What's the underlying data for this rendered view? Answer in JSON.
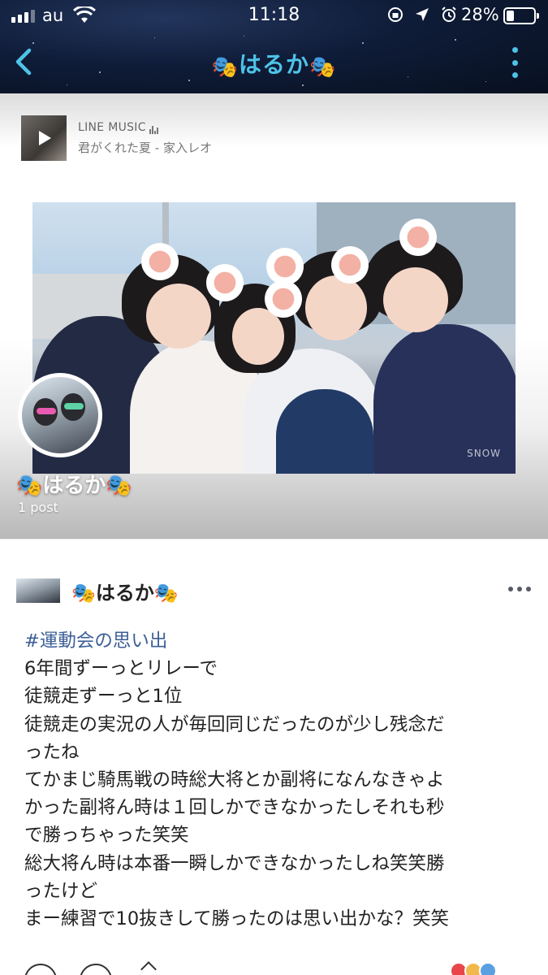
{
  "status_bar": {
    "carrier": "au",
    "time": "11:18",
    "battery_percent": "28%",
    "battery_level": 0.28
  },
  "nav": {
    "title_mask_left": "🎭",
    "title": "はるか",
    "title_mask_right": "🎭"
  },
  "music": {
    "service": "LINE MUSIC",
    "track": "君がくれた夏 - 家入レオ"
  },
  "photo": {
    "watermark": "SNOW"
  },
  "profile": {
    "name_mask_left": "🎭",
    "name": "はるか",
    "name_mask_right": "🎭",
    "post_count": "1 post"
  },
  "post": {
    "author_mask_left": "🎭",
    "author": "はるか",
    "author_mask_right": "🎭",
    "hashtag": "#運動会の思い出",
    "lines": [
      "6年間ずーっとリレーで",
      "徒競走ずーっと1位",
      "徒競走の実況の人が毎回同じだったのが少し残念だ",
      "ったね",
      "てかまじ騎馬戦の時総大将とか副将になんなきゃよ",
      "かった副将ん時は１回しかできなかったしそれも秒",
      "で勝っちゃった笑笑",
      "総大将ん時は本番一瞬しかできなかったしね笑笑勝",
      "ったけど",
      "まー練習で10抜きして勝ったのは思い出かな？笑笑"
    ]
  },
  "colors": {
    "accent": "#4ec3e8",
    "hashtag": "#3c5f97",
    "header_bg": "#0f1c38"
  },
  "icons": {
    "back": "chevron-left-icon",
    "more": "more-vertical-icon",
    "post_more": "more-horizontal-icon",
    "play": "play-icon"
  }
}
